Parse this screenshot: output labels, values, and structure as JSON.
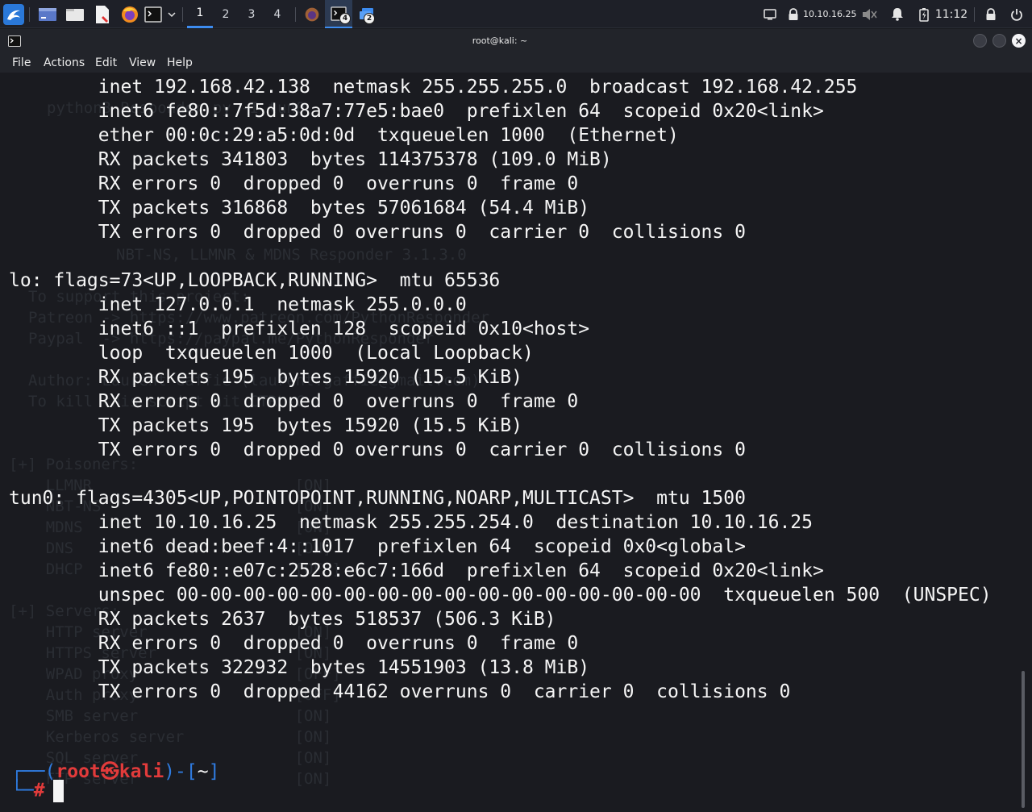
{
  "taskbar": {
    "workspaces": [
      "1",
      "2",
      "3",
      "4"
    ],
    "active_workspace": "1",
    "terminal_task_badge": "4",
    "files_task_badge": "2",
    "ip_address": "10.10.16.25",
    "clock": "11:12",
    "accent_color": "#3d8cf0"
  },
  "window": {
    "title": "root@kali: ~",
    "close_label": "×"
  },
  "menu": [
    "File",
    "Actions",
    "Edit",
    "View",
    "Help"
  ],
  "terminal": {
    "background_ghost": [
      "python3 Responder.py -I tun0",
      "NBT-NS, LLMNR & MDNS Responder 3.1.3.0",
      "To support this project:",
      "Patreon -> https://www.patreon.com/PythonResponder",
      "Paypal  -> https://paypal.me/PythonResponder",
      "Author: Laurent Gaffie (laurent.gaffie@gmail.com)",
      "To kill this script hit CTRL-C",
      "[+] Poisoners:",
      "    LLMNR                      [ON]",
      "    NBT-NS                     [ON]",
      "    MDNS                       [ON]",
      "    DNS                        [ON]",
      "    DHCP                       [OFF]",
      "[+] Servers:",
      "    HTTP server                [ON]",
      "    HTTPS server               [ON]",
      "    WPAD proxy                 [OFF]",
      "    Auth proxy                 [OFF]",
      "    SMB server                 [ON]",
      "    Kerberos server            [ON]",
      "    SQL server                 [ON]",
      "    FTP server                 [ON]"
    ],
    "lines": [
      "        inet 192.168.42.138  netmask 255.255.255.0  broadcast 192.168.42.255",
      "        inet6 fe80::7f5d:38a7:77e5:bae0  prefixlen 64  scopeid 0x20<link>",
      "        ether 00:0c:29:a5:0d:0d  txqueuelen 1000  (Ethernet)",
      "        RX packets 341803  bytes 114375378 (109.0 MiB)",
      "        RX errors 0  dropped 0  overruns 0  frame 0",
      "        TX packets 316868  bytes 57061684 (54.4 MiB)",
      "        TX errors 0  dropped 0 overruns 0  carrier 0  collisions 0",
      "",
      "lo: flags=73<UP,LOOPBACK,RUNNING>  mtu 65536",
      "        inet 127.0.0.1  netmask 255.0.0.0",
      "        inet6 ::1  prefixlen 128  scopeid 0x10<host>",
      "        loop  txqueuelen 1000  (Local Loopback)",
      "        RX packets 195  bytes 15920 (15.5 KiB)",
      "        RX errors 0  dropped 0  overruns 0  frame 0",
      "        TX packets 195  bytes 15920 (15.5 KiB)",
      "        TX errors 0  dropped 0 overruns 0  carrier 0  collisions 0",
      "",
      "tun0: flags=4305<UP,POINTOPOINT,RUNNING,NOARP,MULTICAST>  mtu 1500",
      "        inet 10.10.16.25  netmask 255.255.254.0  destination 10.10.16.25",
      "        inet6 dead:beef:4::1017  prefixlen 64  scopeid 0x0<global>",
      "        inet6 fe80::e07c:2528:e6c7:166d  prefixlen 64  scopeid 0x20<link>",
      "        unspec 00-00-00-00-00-00-00-00-00-00-00-00-00-00-00-00  txqueuelen 500  (UNSPEC)",
      "        RX packets 2637  bytes 518537 (506.3 KiB)",
      "        RX errors 0  dropped 0  overruns 0  frame 0",
      "        TX packets 322932  bytes 14551903 (13.8 MiB)",
      "        TX errors 0  dropped 44162 overruns 0  carrier 0  collisions 0"
    ],
    "prompt": {
      "open": "┌──(",
      "user": "root",
      "skull": "㉿",
      "host": "kali",
      "mid": ")-[",
      "path": "~",
      "close": "]",
      "corner": "└─",
      "symbol": "#"
    },
    "colors": {
      "foreground": "#f5f5f5",
      "prompt_blue": "#2f7bdf",
      "prompt_red": "#e23b3b",
      "background": "#1a1b20"
    }
  }
}
